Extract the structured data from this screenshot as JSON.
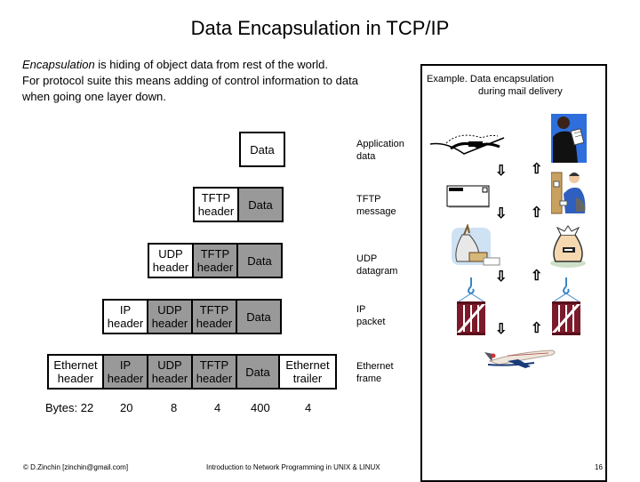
{
  "title": "Data Encapsulation in TCP/IP",
  "intro": {
    "term": "Encapsulation",
    "line1_rest": " is hiding of object data from rest of the world.",
    "line2": "For protocol suite this means adding of control information to data",
    "line3": "when going one layer down."
  },
  "layers": [
    {
      "name": "Application data",
      "label_l1": "Application",
      "label_l2": "data",
      "cells": [
        {
          "l1": "Data",
          "l2": "",
          "fill": "white"
        }
      ]
    },
    {
      "name": "TFTP message",
      "label_l1": "TFTP",
      "label_l2": "message",
      "cells": [
        {
          "l1": "TFTP",
          "l2": "header",
          "fill": "white"
        },
        {
          "l1": "Data",
          "l2": "",
          "fill": "gray"
        }
      ]
    },
    {
      "name": "UDP datagram",
      "label_l1": "UDP",
      "label_l2": "datagram",
      "cells": [
        {
          "l1": "UDP",
          "l2": "header",
          "fill": "white"
        },
        {
          "l1": "TFTP",
          "l2": "header",
          "fill": "gray"
        },
        {
          "l1": "Data",
          "l2": "",
          "fill": "gray"
        }
      ]
    },
    {
      "name": "IP packet",
      "label_l1": "IP",
      "label_l2": "packet",
      "cells": [
        {
          "l1": "IP",
          "l2": "header",
          "fill": "white"
        },
        {
          "l1": "UDP",
          "l2": "header",
          "fill": "gray"
        },
        {
          "l1": "TFTP",
          "l2": "header",
          "fill": "gray"
        },
        {
          "l1": "Data",
          "l2": "",
          "fill": "gray"
        }
      ]
    },
    {
      "name": "Ethernet frame",
      "label_l1": "Ethernet",
      "label_l2": "frame",
      "cells": [
        {
          "l1": "Ethernet",
          "l2": "header",
          "fill": "white"
        },
        {
          "l1": "IP",
          "l2": "header",
          "fill": "gray"
        },
        {
          "l1": "UDP",
          "l2": "header",
          "fill": "gray"
        },
        {
          "l1": "TFTP",
          "l2": "header",
          "fill": "gray"
        },
        {
          "l1": "Data",
          "l2": "",
          "fill": "gray"
        },
        {
          "l1": "Ethernet",
          "l2": "trailer",
          "fill": "white"
        }
      ]
    }
  ],
  "bytes": {
    "label": "Bytes: 22",
    "values": [
      "20",
      "8",
      "4",
      "400",
      "4"
    ]
  },
  "example": {
    "caption_l1": "Example. Data encapsulation",
    "caption_l2": "during mail delivery",
    "down_arrow": "⇩",
    "up_arrow": "⇧",
    "left_column": [
      "letter-writing",
      "envelope",
      "mail-sack",
      "cargo-crate",
      "airplane"
    ],
    "right_column": [
      "person-reading-letter",
      "mail-carrier",
      "money-bag",
      "cargo-crate"
    ]
  },
  "colors": {
    "header_gray": "#999999",
    "crate": "#7b1a2a",
    "hook": "#3a86c8",
    "sky": "#2f6fdd"
  },
  "footer": {
    "left": "© D.Zinchin [zinchin@gmail.com]",
    "center": "Introduction to Network Programming in UNIX & LINUX",
    "page": "16"
  }
}
